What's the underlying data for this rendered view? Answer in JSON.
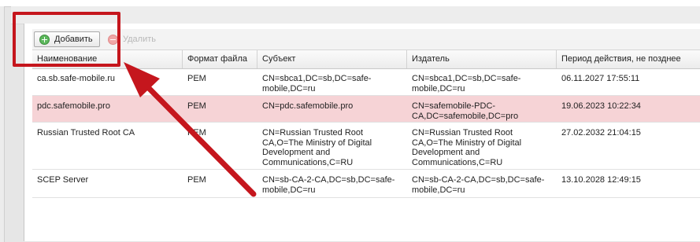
{
  "toolbar": {
    "add_label": "Добавить",
    "delete_label": "Удалить"
  },
  "table": {
    "columns": [
      "Наименование",
      "Формат файла",
      "Субъект",
      "Издатель",
      "Период действия, не позднее"
    ],
    "rows": [
      {
        "name": "ca.sb.safe-mobile.ru",
        "format": "PEM",
        "subject": [
          "CN=sbca1,DC=sb,DC=safe-",
          "mobile,DC=ru"
        ],
        "issuer": [
          "CN=sbca1,DC=sb,DC=safe-",
          "mobile,DC=ru"
        ],
        "valid_until": "06.11.2027 17:55:11",
        "selected": false
      },
      {
        "name": "pdc.safemobile.pro",
        "format": "PEM",
        "subject": [
          "CN=pdc.safemobile.pro"
        ],
        "issuer": [
          "CN=safemobile-PDC-",
          "CA,DC=safemobile,DC=pro"
        ],
        "valid_until": "19.06.2023 10:22:34",
        "selected": true
      },
      {
        "name": "Russian Trusted Root CA",
        "format": "PEM",
        "subject": [
          "CN=Russian Trusted Root",
          "CA,O=The Ministry of Digital",
          "Development and",
          "Communications,C=RU"
        ],
        "issuer": [
          "CN=Russian Trusted Root",
          "CA,O=The Ministry of Digital",
          "Development and",
          "Communications,C=RU"
        ],
        "valid_until": "27.02.2032 21:04:15",
        "selected": false
      },
      {
        "name": "SCEP Server",
        "format": "PEM",
        "subject": [
          "CN=sb-CA-2-CA,DC=sb,DC=safe-",
          "mobile,DC=ru"
        ],
        "issuer": [
          "CN=sb-CA-2-CA,DC=sb,DC=safe-",
          "mobile,DC=ru"
        ],
        "valid_until": "13.10.2028 12:49:15",
        "selected": false
      }
    ]
  },
  "icons": {
    "add": "plus-circle-icon",
    "delete": "minus-circle-icon"
  },
  "colors": {
    "selected_row": "#f6d3d6",
    "annotation": "#c5161d",
    "add_icon": "#5cb85c",
    "delete_icon_disabled": "#f0a6a6"
  }
}
